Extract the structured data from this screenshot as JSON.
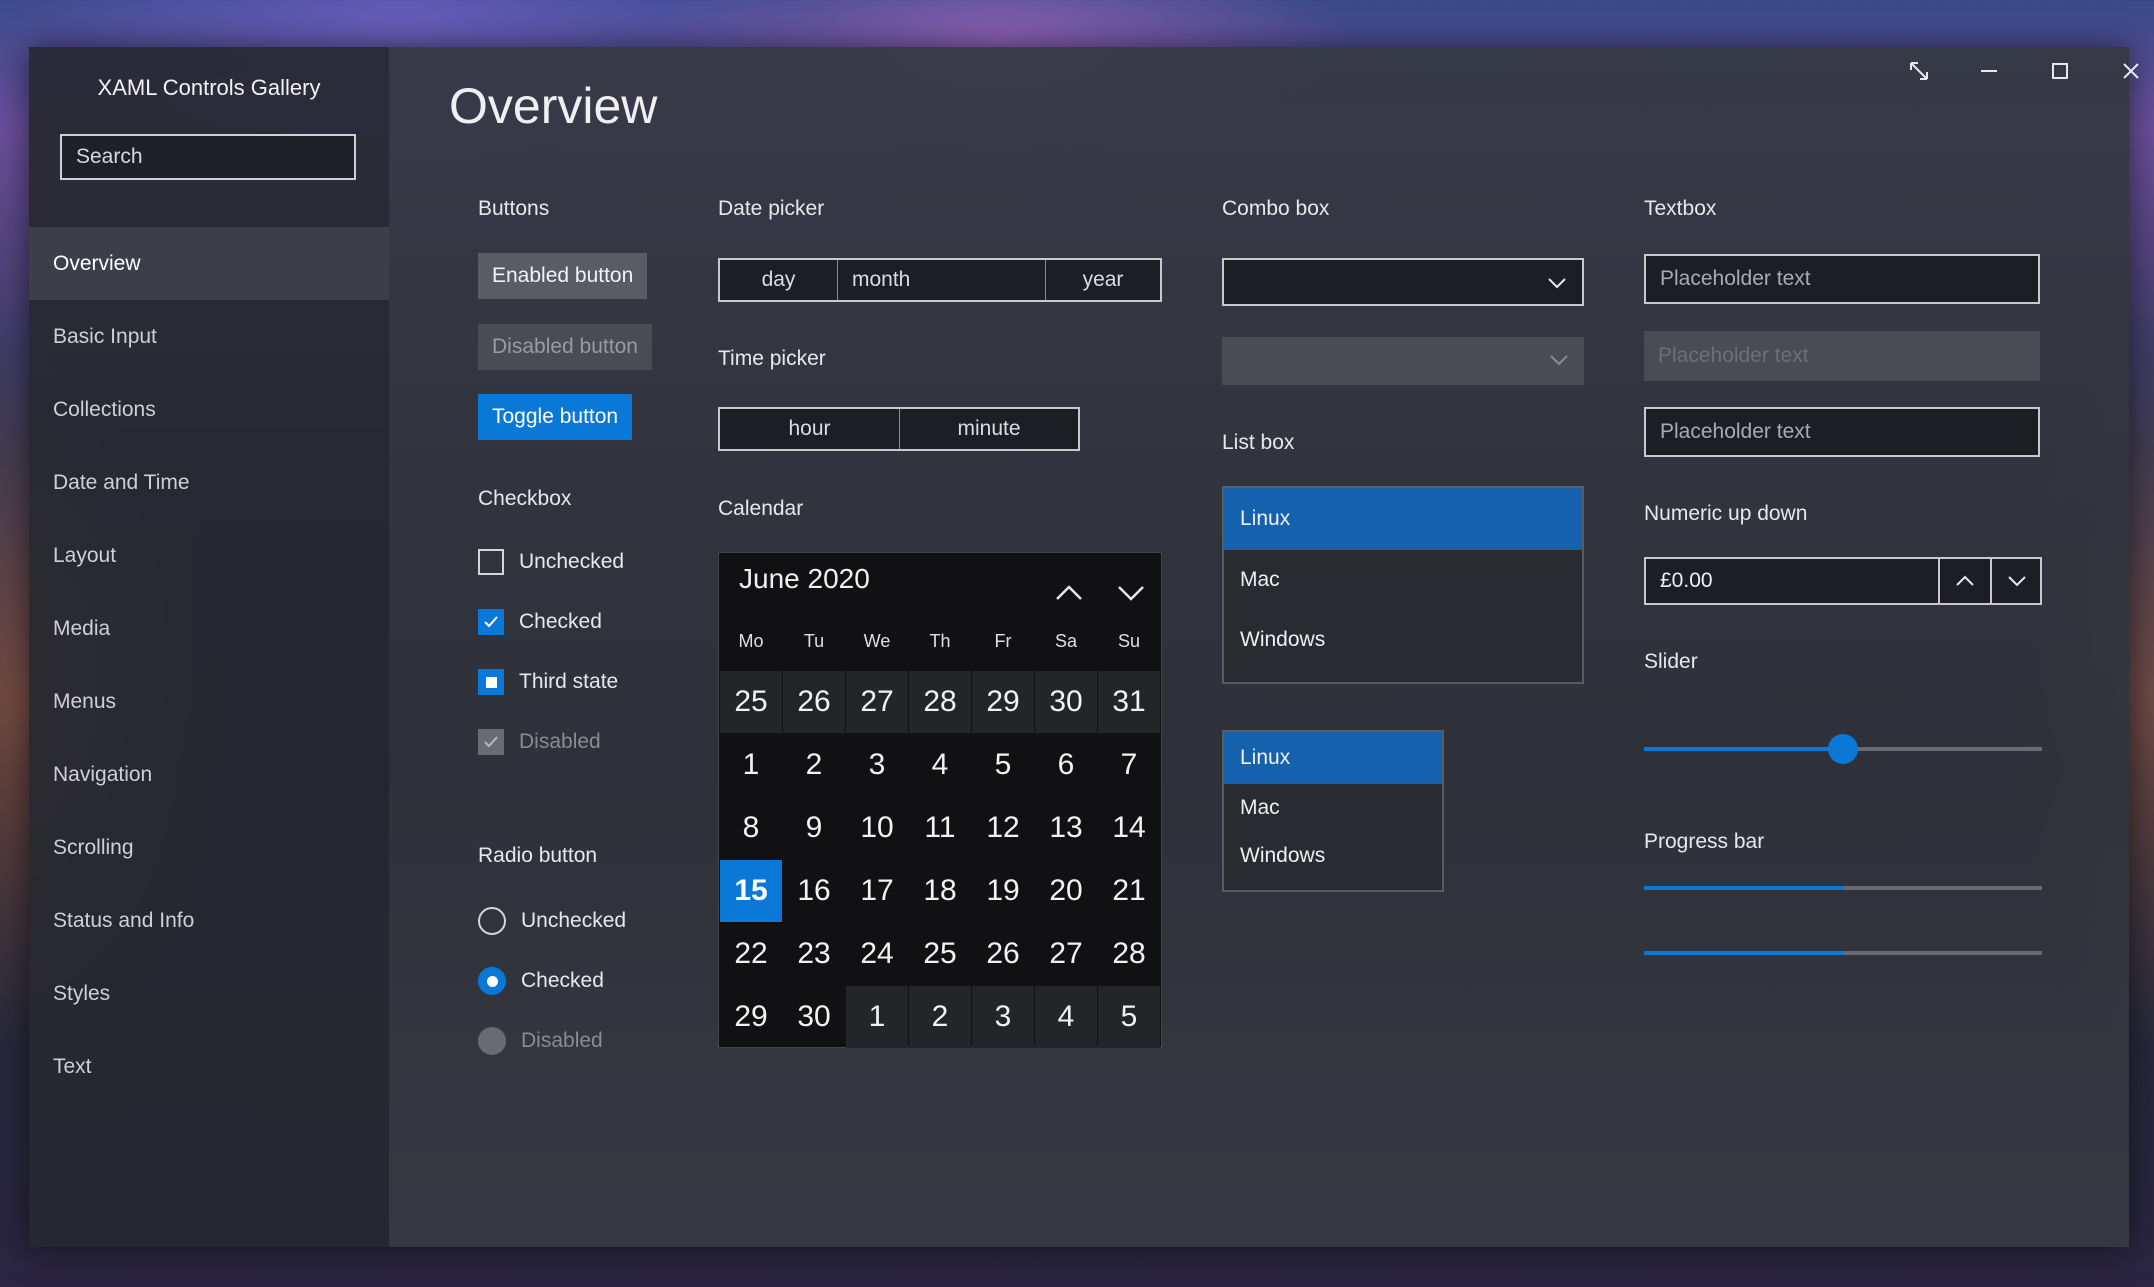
{
  "app": {
    "title": "XAML Controls Gallery",
    "search_placeholder": "Search"
  },
  "window_controls": {
    "resize": "⤡",
    "minimize": "—",
    "maximize": "☐",
    "close": "✕"
  },
  "nav": {
    "items": [
      {
        "label": "Overview",
        "active": true
      },
      {
        "label": "Basic Input"
      },
      {
        "label": "Collections"
      },
      {
        "label": "Date and Time"
      },
      {
        "label": "Layout"
      },
      {
        "label": "Media"
      },
      {
        "label": "Menus"
      },
      {
        "label": "Navigation"
      },
      {
        "label": "Scrolling"
      },
      {
        "label": "Status and Info"
      },
      {
        "label": "Styles"
      },
      {
        "label": "Text"
      }
    ]
  },
  "page": {
    "title": "Overview"
  },
  "buttons": {
    "heading": "Buttons",
    "enabled": "Enabled button",
    "disabled": "Disabled button",
    "toggle": "Toggle button"
  },
  "checkbox": {
    "heading": "Checkbox",
    "unchecked": "Unchecked",
    "checked": "Checked",
    "third": "Third state",
    "disabled": "Disabled"
  },
  "radio": {
    "heading": "Radio button",
    "unchecked": "Unchecked",
    "checked": "Checked",
    "disabled": "Disabled"
  },
  "datepicker": {
    "heading": "Date picker",
    "day": "day",
    "month": "month",
    "year": "year"
  },
  "timepicker": {
    "heading": "Time picker",
    "hour": "hour",
    "minute": "minute"
  },
  "calendar": {
    "heading": "Calendar",
    "month_label": "June 2020",
    "days_of_week": [
      "Mo",
      "Tu",
      "We",
      "Th",
      "Fr",
      "Sa",
      "Su"
    ],
    "weeks": [
      [
        "25",
        "26",
        "27",
        "28",
        "29",
        "30",
        "31"
      ],
      [
        "1",
        "2",
        "3",
        "4",
        "5",
        "6",
        "7"
      ],
      [
        "8",
        "9",
        "10",
        "11",
        "12",
        "13",
        "14"
      ],
      [
        "15",
        "16",
        "17",
        "18",
        "19",
        "20",
        "21"
      ],
      [
        "22",
        "23",
        "24",
        "25",
        "26",
        "27",
        "28"
      ],
      [
        "29",
        "30",
        "1",
        "2",
        "3",
        "4",
        "5"
      ]
    ],
    "today": "15"
  },
  "combobox": {
    "heading": "Combo box"
  },
  "listbox": {
    "heading": "List box",
    "items": [
      "Linux",
      "Mac",
      "Windows"
    ],
    "selected": "Linux",
    "compact_items": [
      "Linux",
      "Mac",
      "Windows"
    ]
  },
  "textbox": {
    "heading": "Textbox",
    "placeholder1": "Placeholder text",
    "placeholder2": "Placeholder text",
    "placeholder3": "Placeholder text"
  },
  "numeric": {
    "heading": "Numeric up down",
    "value": "£0.00"
  },
  "slider": {
    "heading": "Slider",
    "value": 0.5
  },
  "progress": {
    "heading": "Progress bar",
    "value1": 0.5,
    "value2": 0.5
  },
  "colors": {
    "accent": "#0a78d7",
    "list_selected": "#1661ad"
  }
}
